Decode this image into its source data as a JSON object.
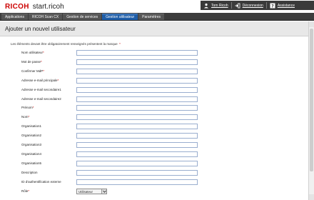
{
  "header": {
    "logo": "RICOH",
    "app_title": "start.ricoh",
    "user_name": "Tom Ricoh",
    "logout_label": "Déconnexion",
    "help_label": "Assistance"
  },
  "nav": {
    "tabs": [
      {
        "label": "Applications"
      },
      {
        "label": "RICOH Scan CX"
      },
      {
        "label": "Gestion de services"
      },
      {
        "label": "Gestion utilisateur"
      },
      {
        "label": "Paramètres"
      }
    ],
    "active_index": 3
  },
  "page": {
    "title": "Ajouter un nouvel utilisateur",
    "required_note": "Les éléments devant être obligatoirement renseignés présentent la marque"
  },
  "form": {
    "fields": [
      {
        "label": "Nom utilisateur",
        "required": true
      },
      {
        "label": "Mot de passe",
        "required": true
      },
      {
        "label": "Confirmer MdP",
        "required": true
      },
      {
        "label": "Adresse e-mail principale",
        "required": true
      },
      {
        "label": "Adresse e-mail secondaire1",
        "required": false
      },
      {
        "label": "Adresse e-mail secondaire2",
        "required": false
      },
      {
        "label": "Prénom",
        "required": true
      },
      {
        "label": "Nom",
        "required": true
      },
      {
        "label": "Organisation1",
        "required": false
      },
      {
        "label": "Organisation2",
        "required": false
      },
      {
        "label": "Organisation3",
        "required": false
      },
      {
        "label": "Organisation4",
        "required": false
      },
      {
        "label": "Organisation5",
        "required": false
      },
      {
        "label": "Description",
        "required": false
      },
      {
        "label": "ID d'authentification externe",
        "required": false
      }
    ],
    "role": {
      "label": "Rôle",
      "required": true,
      "value": "Utilisateur"
    }
  },
  "colors": {
    "brand_red": "#cc0000",
    "active_tab": "#1f5ea8",
    "nav_bg": "#3d3d3d"
  },
  "icons": [
    "user-icon",
    "logout-icon",
    "help-icon",
    "chevron-down-icon"
  ]
}
